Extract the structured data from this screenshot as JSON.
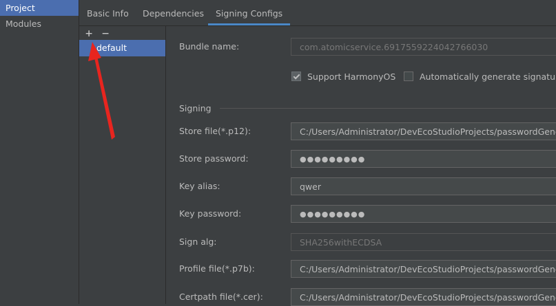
{
  "nav": {
    "items": [
      {
        "label": "Project"
      },
      {
        "label": "Modules"
      }
    ]
  },
  "tabs": [
    {
      "label": "Basic Info"
    },
    {
      "label": "Dependencies"
    },
    {
      "label": "Signing Configs"
    }
  ],
  "configs": {
    "add_symbol": "+",
    "remove_symbol": "−",
    "items": [
      {
        "label": "default"
      }
    ]
  },
  "form": {
    "bundle_name": {
      "label": "Bundle name:",
      "value": "com.atomicservice.6917559224042766030"
    },
    "support_harmonyos": {
      "label": "Support HarmonyOS",
      "checked": true
    },
    "auto_generate": {
      "label": "Automatically generate signature",
      "checked": false
    },
    "section_title": "Signing",
    "store_file": {
      "label": "Store file(*.p12):",
      "value": "C:/Users/Administrator/DevEcoStudioProjects/passwordGenerat"
    },
    "store_password": {
      "label": "Store password:",
      "value": "●●●●●●●●●"
    },
    "key_alias": {
      "label": "Key alias:",
      "value": "qwer"
    },
    "key_password": {
      "label": "Key password:",
      "value": "●●●●●●●●●"
    },
    "sign_alg": {
      "label": "Sign alg:",
      "value": "SHA256withECDSA"
    },
    "profile_file": {
      "label": "Profile file(*.p7b):",
      "value": "C:/Users/Administrator/DevEcoStudioProjects/passwordGenerat"
    },
    "certpath_file": {
      "label": "Certpath file(*.cer):",
      "value": "C:/Users/Administrator/DevEcoStudioProjects/passwordGenerat"
    }
  },
  "colors": {
    "background": "#3c3f41",
    "selection": "#4b6eaf",
    "tab_underline": "#4a88c7",
    "annotation_arrow": "#e8251f"
  }
}
